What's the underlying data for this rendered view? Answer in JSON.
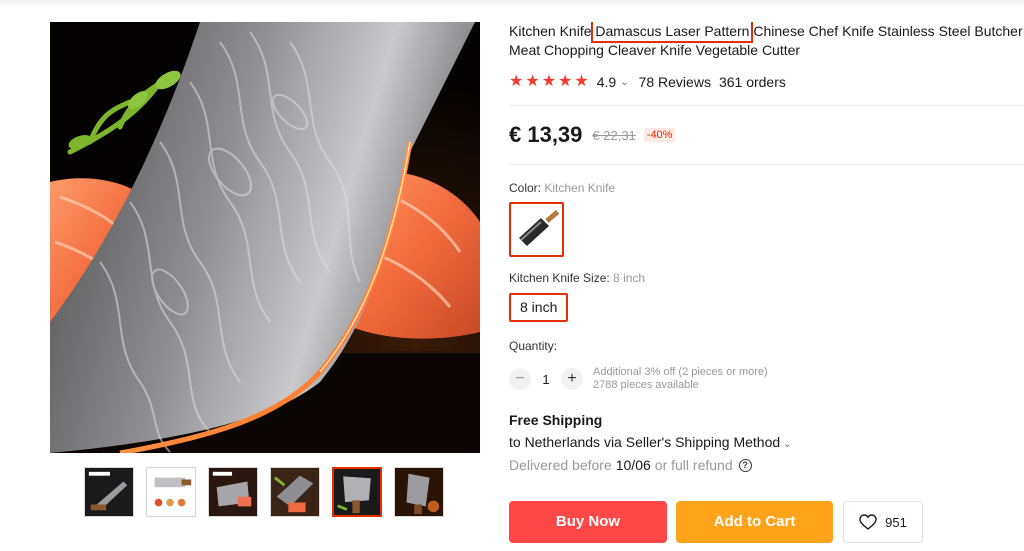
{
  "product": {
    "title_before": "Kitchen Knife ",
    "title_highlight": "Damascus Laser Pattern",
    "title_after": " Chinese Chef Knife Stainless Steel Butcher Meat Chopping Cleaver Knife Vegetable Cutter",
    "rating": "4.9",
    "reviews": "78 Reviews",
    "orders": "361 orders",
    "stars": 5
  },
  "price": {
    "current": "€ 13,39",
    "original": "€ 22,31",
    "discount": "-40%"
  },
  "color": {
    "label": "Color:",
    "selected": "Kitchen Knife"
  },
  "size": {
    "label": "Kitchen Knife Size:",
    "selected": "8 inch",
    "option": "8 inch"
  },
  "quantity": {
    "label": "Quantity:",
    "value": "1",
    "minus": "−",
    "plus": "+",
    "offer": "Additional 3% off (2 pieces or more)",
    "available": "2788 pieces available"
  },
  "shipping": {
    "title": "Free Shipping",
    "method": "to Netherlands via Seller's Shipping Method",
    "delivered_prefix": "Delivered before",
    "date": "10/06",
    "delivered_suffix": "or full refund",
    "help": "?"
  },
  "actions": {
    "buy_now": "Buy Now",
    "add_to_cart": "Add to Cart",
    "wishlist_count": "951"
  },
  "icons": {
    "star": "star-icon",
    "chevron": "chevron-down-icon",
    "help": "question-circle-icon",
    "heart": "heart-icon"
  },
  "colors": {
    "accent": "#e62e04",
    "buy": "#ff4747",
    "cart": "#ffa41a",
    "star": "#f43a2e"
  },
  "gallery": {
    "thumbnail_count": 6,
    "active_index": 4
  }
}
